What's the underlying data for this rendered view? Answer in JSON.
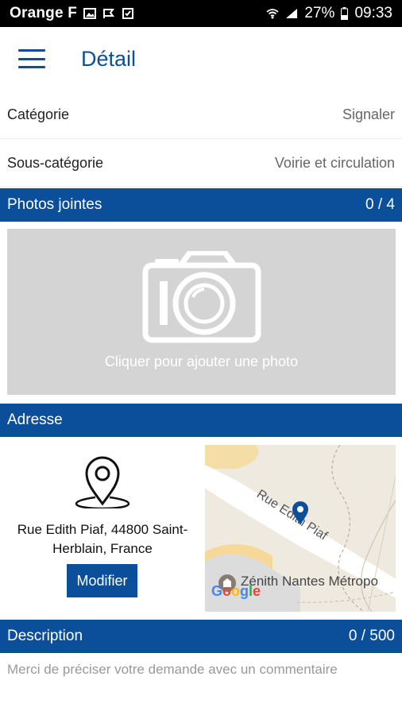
{
  "status_bar": {
    "carrier": "Orange F",
    "battery": "27%",
    "time": "09:33"
  },
  "header": {
    "title": "Détail"
  },
  "fields": [
    {
      "label": "Catégorie",
      "value": "Signaler"
    },
    {
      "label": "Sous-catégorie",
      "value": "Voirie et circulation"
    }
  ],
  "photos": {
    "title": "Photos jointes",
    "count": "0 / 4",
    "add_label": "Cliquer pour ajouter une photo"
  },
  "address": {
    "title": "Adresse",
    "line1": "Rue Edith Piaf, 44800 Saint-",
    "line2": "Herblain, France",
    "modify_label": "Modifier",
    "map": {
      "street": "Rue Edith Piaf",
      "poi": "Zénith Nantes Métropo",
      "logo": "Google"
    }
  },
  "description": {
    "title": "Description",
    "count": "0 / 500",
    "placeholder": "Merci de préciser votre demande avec un commentaire"
  },
  "colors": {
    "primary": "#0b4f9a",
    "photo_bg": "#d4d4d4",
    "map_bg": "#efeae0",
    "pin": "#0b4f9a"
  }
}
